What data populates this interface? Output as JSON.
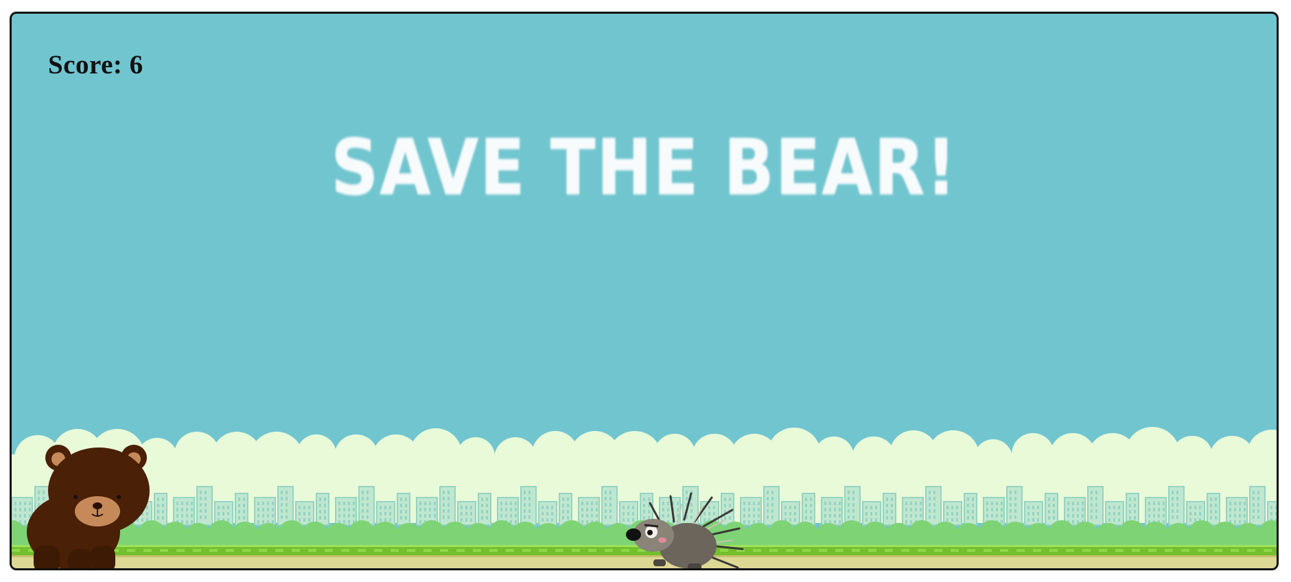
{
  "hud": {
    "score_label": "Score: 6",
    "score": 6
  },
  "title": "SAVE THE BEAR!",
  "scene": {
    "sky_color": "#71c5cf",
    "cloud_color": "#e9fad9",
    "building_color": "#a9dfc8",
    "bush_color": "#7ed375",
    "grass_color": "#73bf2e",
    "ground_color": "#ded895"
  },
  "characters": {
    "player": "bear-icon",
    "enemy": "porcupine-icon"
  }
}
